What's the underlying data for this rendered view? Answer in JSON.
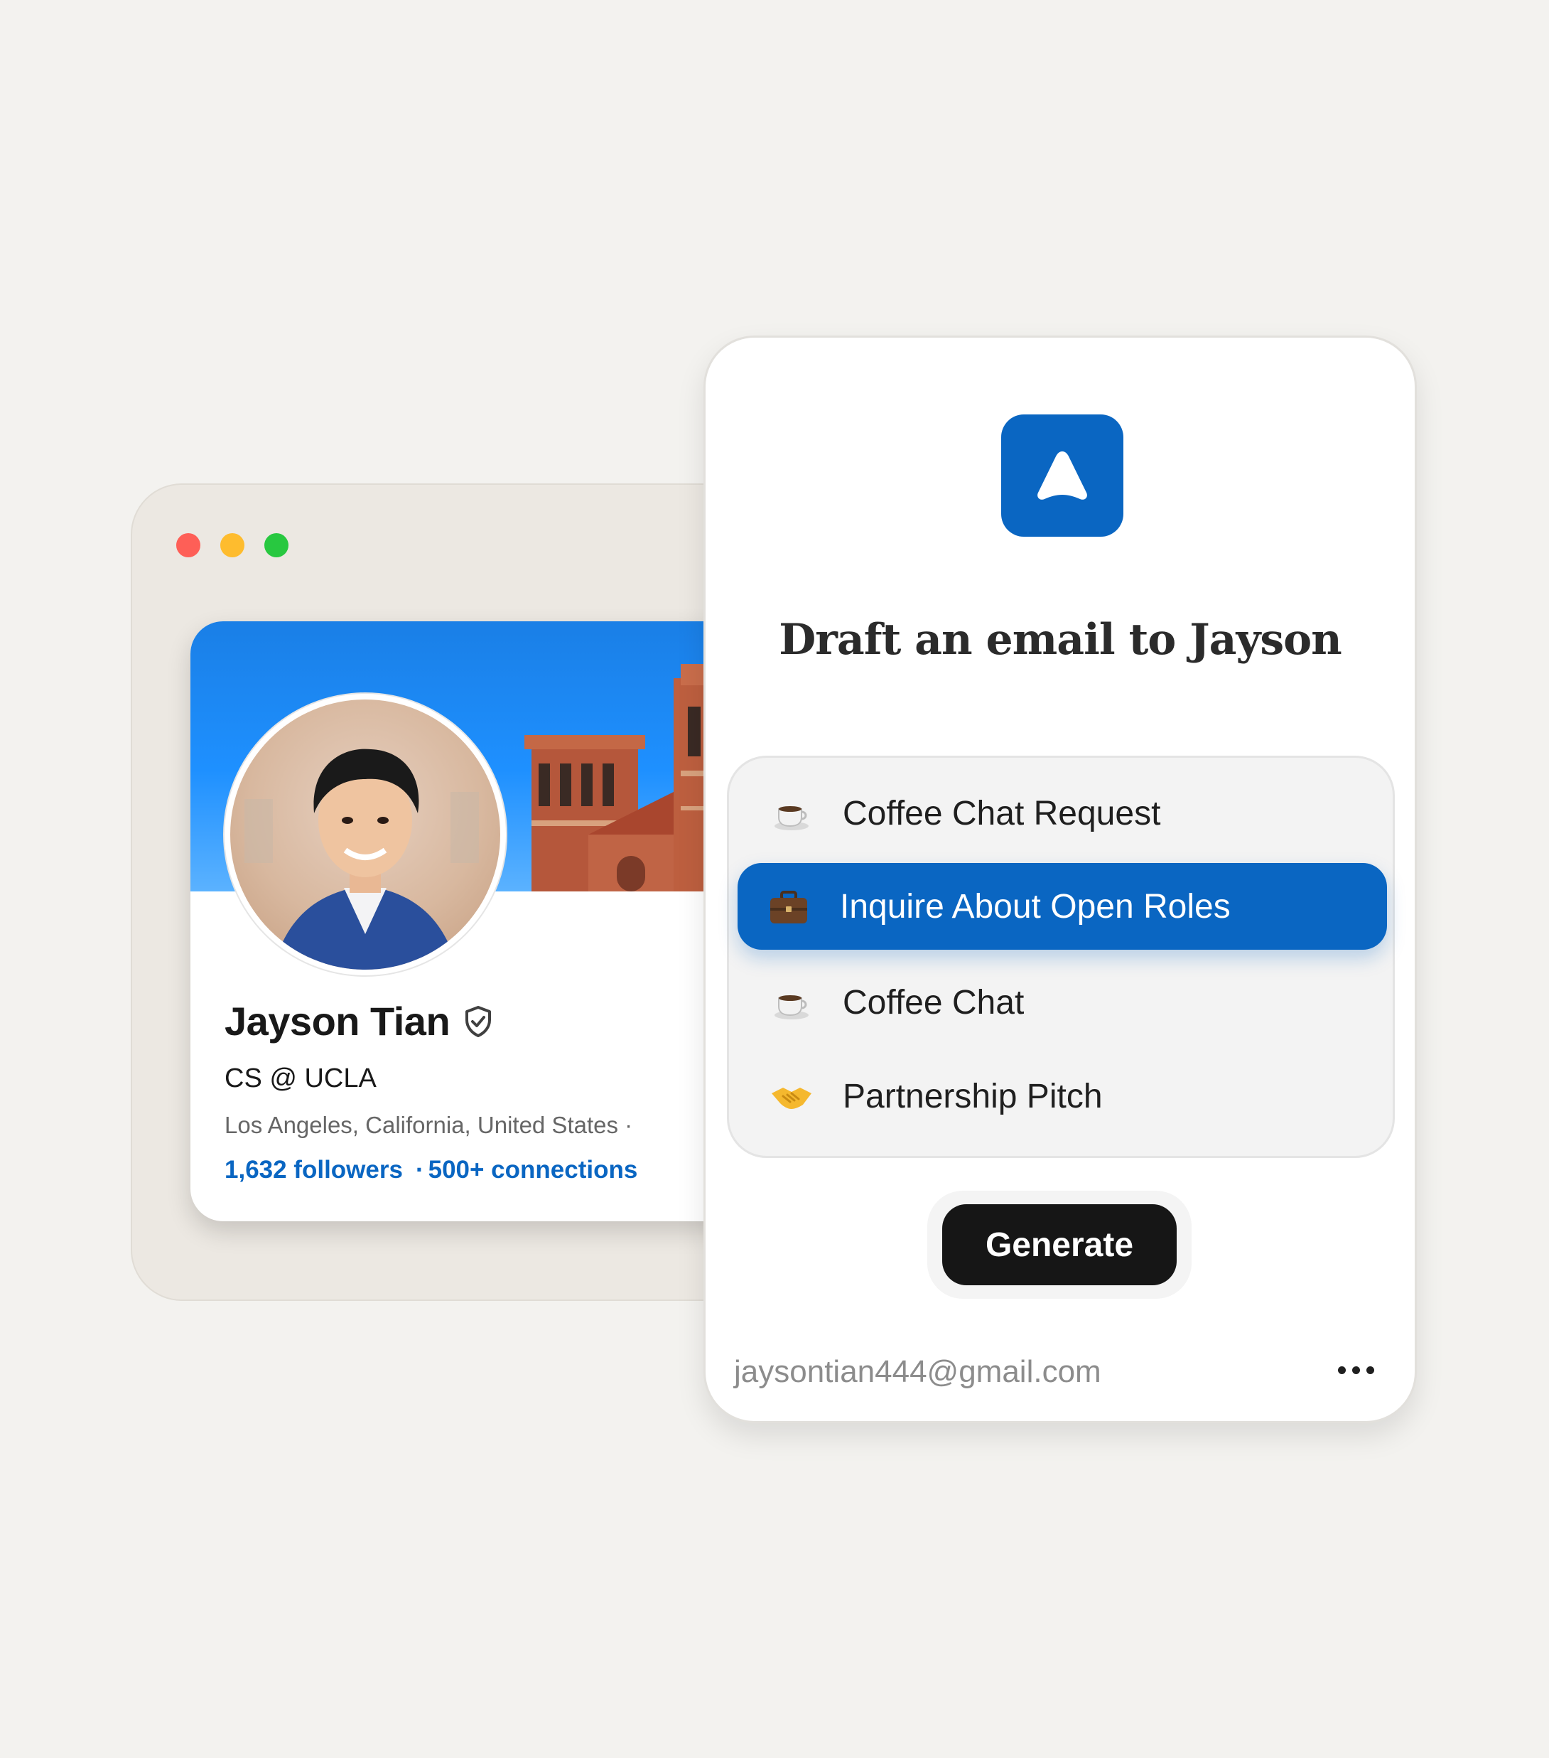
{
  "browser": {
    "traffic_lights": [
      "close",
      "minimize",
      "maximize"
    ],
    "colors": {
      "close": "#fe5f57",
      "minimize": "#febc2e",
      "maximize": "#28c840"
    }
  },
  "profile": {
    "name": "Jayson Tian",
    "headline": "CS @ UCLA",
    "location": "Los Angeles, California, United States ·",
    "followers": "1,632 followers",
    "separator": "·",
    "connections": "500+ connections",
    "verified_icon": "shield-check-icon",
    "link_color": "#0a66c2"
  },
  "popup": {
    "logo_icon": "triangle-arrow-icon",
    "accent": "#0a66c2",
    "title": "Draft an email to Jayson",
    "templates": [
      {
        "emoji": "coffee-icon",
        "label": "Coffee Chat Request",
        "selected": false
      },
      {
        "emoji": "briefcase-icon",
        "label": "Inquire About Open Roles",
        "selected": true
      },
      {
        "emoji": "coffee-icon",
        "label": "Coffee Chat",
        "selected": false
      },
      {
        "emoji": "handshake-icon",
        "label": "Partnership Pitch",
        "selected": false
      }
    ],
    "generate_label": "Generate",
    "user_email": "jaysontian444@gmail.com",
    "more_icon": "ellipsis-icon"
  }
}
